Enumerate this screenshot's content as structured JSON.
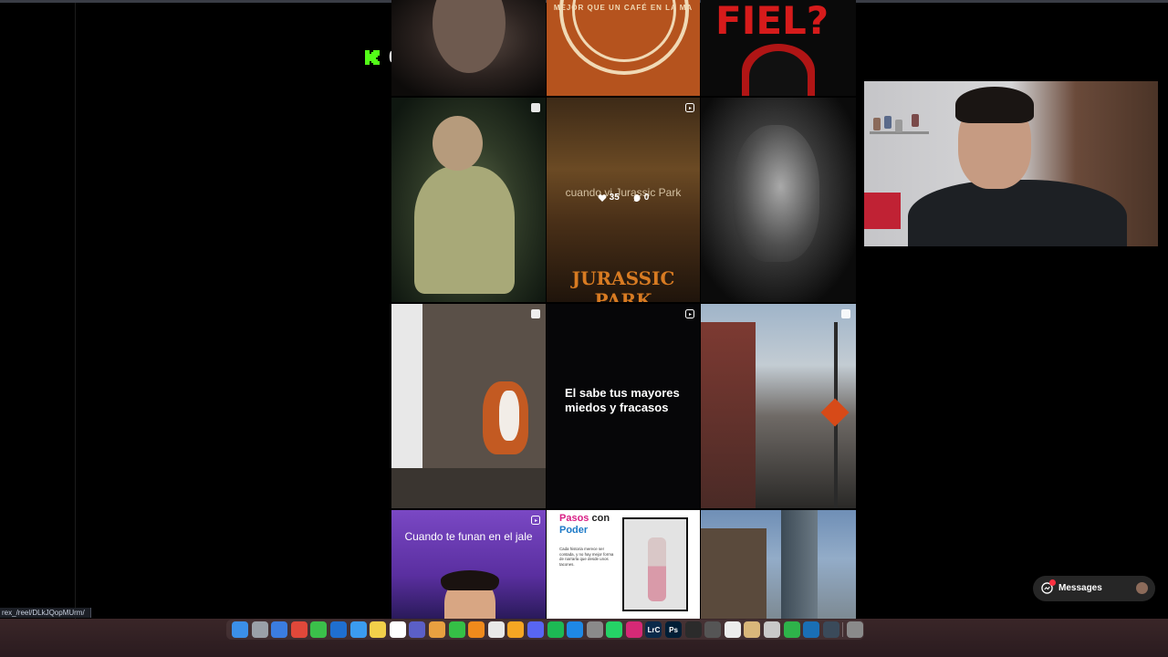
{
  "kick": {
    "count": "0"
  },
  "status_url": "rex_/reel/DLkJQopMUrm/",
  "messages": {
    "label": "Messages",
    "badge": "1"
  },
  "grid": {
    "tiles": [
      {
        "name": "post-face-closeup",
        "badge": "none"
      },
      {
        "name": "post-coffee-logo",
        "text": "MEJOR QUE UN CAFÉ EN LA MA",
        "badge": "none"
      },
      {
        "name": "post-fiel-jurassic",
        "text": "FIEL?",
        "badge": "none"
      },
      {
        "name": "post-old-man-jungle",
        "badge": "carousel"
      },
      {
        "name": "post-jurassic-park-poster",
        "caption": "cuando vi Jurassic Park",
        "likes": "35",
        "comments": "0",
        "title": "JURASSIC PARK",
        "badge": "reel"
      },
      {
        "name": "post-bw-portrait",
        "badge": "none"
      },
      {
        "name": "post-squirrel-tree",
        "badge": "carousel"
      },
      {
        "name": "post-text-miedos",
        "text": "El sabe tus mayores miedos y fracasos",
        "badge": "reel"
      },
      {
        "name": "post-street-photo",
        "badge": "carousel"
      },
      {
        "name": "post-cuando-te-funan",
        "text": "Cuando te funan en el jale",
        "badge": "reel"
      },
      {
        "name": "post-pasos-con-poder",
        "title_a": "Pasos",
        "title_b": "con",
        "title_c": "Poder",
        "body": "Cada historia merece ser contada, y no hay mejor forma de narrarla que desde unos tacones.",
        "badge": "none"
      },
      {
        "name": "post-torre-latinoamericana",
        "badge": "none"
      }
    ]
  },
  "dock": {
    "apps": [
      {
        "name": "finder-icon",
        "color": "#3b8fe8"
      },
      {
        "name": "launchpad-icon",
        "color": "#9aa0a8"
      },
      {
        "name": "safari-icon",
        "color": "#3b7de0"
      },
      {
        "name": "chrome-icon",
        "color": "#e0483a"
      },
      {
        "name": "messages-app-icon",
        "color": "#3bc04a"
      },
      {
        "name": "outlook-icon",
        "color": "#1f6fd0"
      },
      {
        "name": "mail-icon",
        "color": "#3b9cf0"
      },
      {
        "name": "notes-icon",
        "color": "#f2d04a"
      },
      {
        "name": "calendar-icon",
        "color": "#ffffff"
      },
      {
        "name": "teams-icon",
        "color": "#5b5fc7"
      },
      {
        "name": "photos-icon",
        "color": "#e8a040"
      },
      {
        "name": "facetime-icon",
        "color": "#35c046"
      },
      {
        "name": "books-icon",
        "color": "#f08a1c"
      },
      {
        "name": "textedit-icon",
        "color": "#e8e8e8"
      },
      {
        "name": "pages-icon",
        "color": "#f5a623"
      },
      {
        "name": "discord-icon",
        "color": "#5865f2"
      },
      {
        "name": "spotify-icon",
        "color": "#1db954"
      },
      {
        "name": "app-store-icon",
        "color": "#1e88e5"
      },
      {
        "name": "system-settings-icon",
        "color": "#8a8a8a"
      },
      {
        "name": "whatsapp-icon",
        "color": "#25d366"
      },
      {
        "name": "instagram-icon",
        "color": "#d62976"
      },
      {
        "name": "lightroom-icon",
        "color": "#0b2a4a",
        "label": "LrC"
      },
      {
        "name": "photoshop-icon",
        "color": "#001e36",
        "label": "Ps"
      },
      {
        "name": "davinci-icon",
        "color": "#2b2b2b"
      },
      {
        "name": "pinwheel-icon",
        "color": "#555555"
      },
      {
        "name": "notion-icon",
        "color": "#ececec"
      },
      {
        "name": "script-editor-icon",
        "color": "#d9b77a"
      },
      {
        "name": "preview-icon",
        "color": "#c9c9c9"
      },
      {
        "name": "numbers-icon",
        "color": "#2eb34a"
      },
      {
        "name": "quicktime-icon",
        "color": "#1a6fb5"
      },
      {
        "name": "screenshot-icon",
        "color": "#3a4a5a"
      },
      {
        "name": "trash-icon",
        "color": "#8a8a8a"
      }
    ]
  },
  "colors": {
    "kick_green": "#53fc18",
    "jurassic_orange": "#d87b22",
    "fiel_red": "#d61b1b",
    "pasos_pink": "#d81f84",
    "poder_blue": "#1d7ac7"
  }
}
